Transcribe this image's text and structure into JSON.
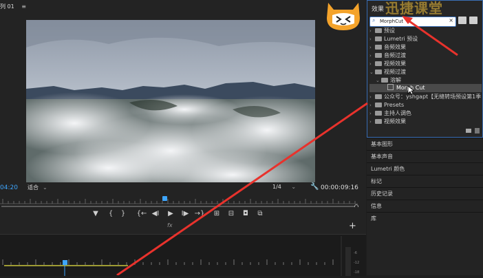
{
  "monitor": {
    "tab_label": "列 01",
    "menu_glyph": "≡",
    "timecode": "04:20",
    "fit_label": "适合",
    "resolution_label": "1/4",
    "duration": "00:00:09:16"
  },
  "transport": {
    "marker": "▼",
    "in_point": "{",
    "out_point": "}",
    "go_in": "{←",
    "step_back": "◀I",
    "play": "▶",
    "step_fwd": "I▶",
    "go_out": "→}",
    "lift": "⊞",
    "extract": "⊟",
    "export_frame": "◘",
    "compare": "⧉",
    "fx_label": "fx",
    "add": "+"
  },
  "effects": {
    "tab_label": "效果",
    "watermark": "迅捷课堂",
    "search_value": "MorphCut",
    "search_clear": "×",
    "items": [
      {
        "arrow": "›",
        "label": "预设"
      },
      {
        "arrow": "›",
        "label": "Lumetri 预设"
      },
      {
        "arrow": "›",
        "label": "音频效果"
      },
      {
        "arrow": "›",
        "label": "音频过渡"
      },
      {
        "arrow": "›",
        "label": "视频效果"
      },
      {
        "arrow": "⌄",
        "label": "视频过渡"
      },
      {
        "arrow": "⌄",
        "label": "溶解"
      },
      {
        "arrow": "",
        "label": "Morph Cut"
      },
      {
        "arrow": "›",
        "label": "公众号：yshgapt【无缝转场预设第1季"
      },
      {
        "arrow": "›",
        "label": "Presets"
      },
      {
        "arrow": "›",
        "label": "主持人调色"
      },
      {
        "arrow": "›",
        "label": "视频效果"
      }
    ]
  },
  "panels": [
    "基本图形",
    "基本声音",
    "Lumetri 颜色",
    "标记",
    "历史记录",
    "信息",
    "库"
  ],
  "colors": {
    "accent": "#3a6fb7",
    "timecode": "#3ea6ff",
    "annotation_arrow": "#e8322c"
  }
}
